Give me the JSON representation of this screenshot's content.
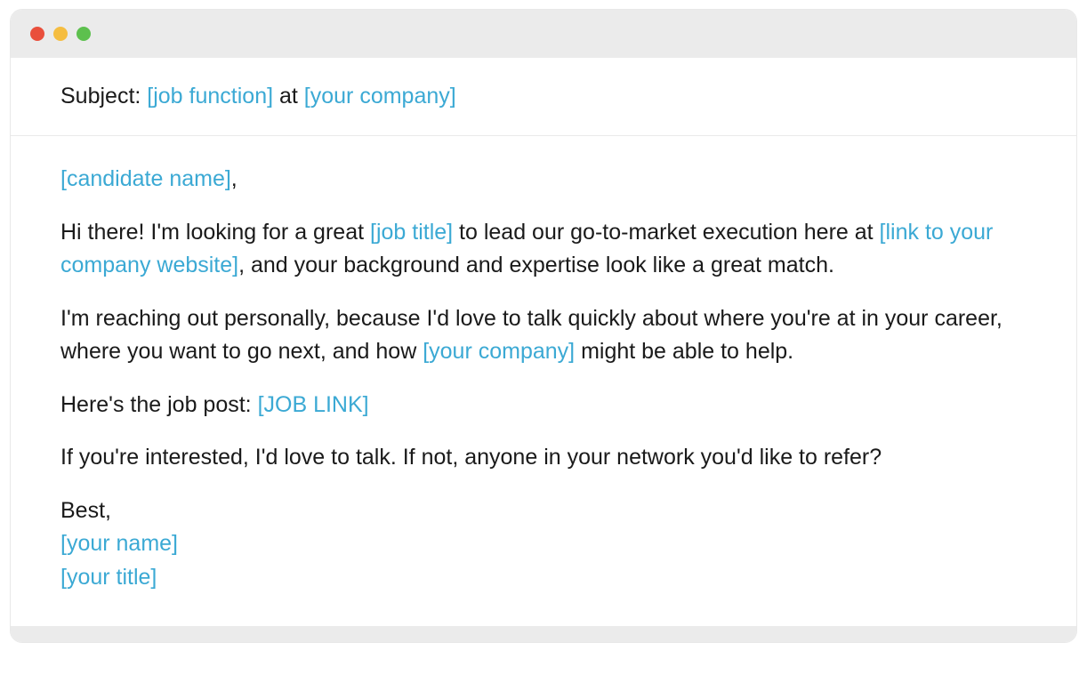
{
  "subject": {
    "label": "Subject: ",
    "placeholder1": "[job function]",
    "connector": " at ",
    "placeholder2": "[your company]"
  },
  "greeting": {
    "placeholder": "[candidate name]",
    "comma": ","
  },
  "para1": {
    "t1": "Hi there! I'm looking for a great ",
    "p1": "[job title]",
    "t2": " to lead our go-to-market  execution here at ",
    "p2": "[link to your company website]",
    "t3": ", and your  background and expertise look like a great match."
  },
  "para2": {
    "t1": "I'm reaching out personally, because I'd love to talk quickly about  where you're at in your career, where you want to go next, and  how ",
    "p1": "[your company]",
    "t2": " might be able to help."
  },
  "para3": {
    "t1": "Here's the job post:  ",
    "p1": "[JOB LINK]"
  },
  "para4": {
    "t1": "If you're interested, I'd love to talk. If not, anyone in your network  you'd like to refer?"
  },
  "signoff": {
    "best": "Best,",
    "name": "[your name]",
    "title": "[your title]"
  }
}
